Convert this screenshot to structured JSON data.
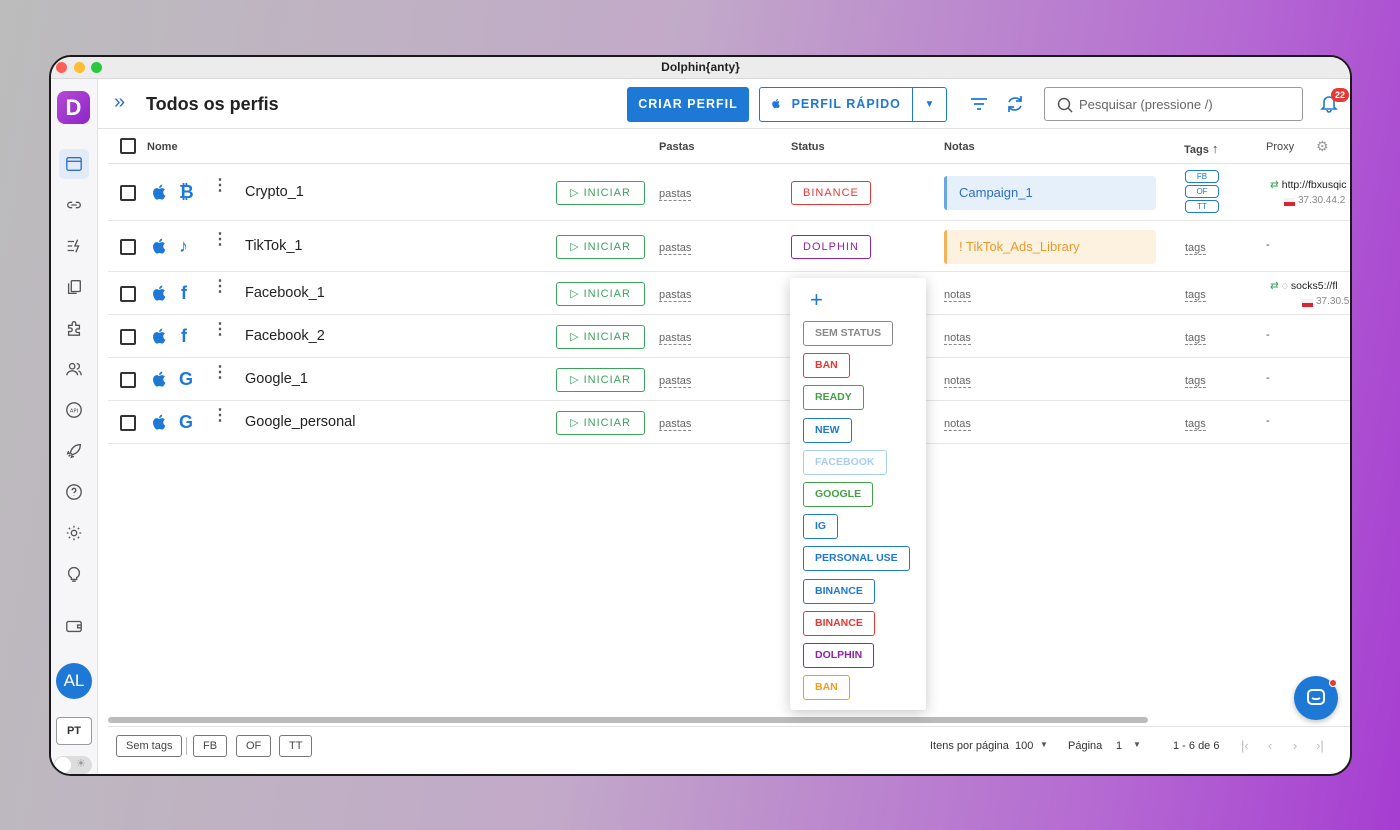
{
  "window": {
    "title": "Dolphin{anty}"
  },
  "sidebar": {
    "logo": "D",
    "avatar": "AL",
    "lang": "PT",
    "theme_toggle_icon": "sun-icon"
  },
  "header": {
    "title": "Todos os perfis",
    "create_button": "CRIAR PERFIL",
    "quick_button": "PERFIL RÁPIDO",
    "search_placeholder": "Pesquisar (pressione /)",
    "notifications": "22"
  },
  "table": {
    "headers": {
      "name": "Nome",
      "folders": "Pastas",
      "status": "Status",
      "notes": "Notas",
      "tags": "Tags",
      "proxy": "Proxy"
    },
    "start_label": "▷ INICIAR",
    "folders_placeholder": "pastas",
    "notes_placeholder": "notas",
    "tags_placeholder": "tags",
    "empty_value": "-",
    "rows": [
      {
        "name": "Crypto_1",
        "brand_icon": "bitcoin-icon",
        "brand": "₿",
        "status": "BINANCE",
        "status_color": "#e53935",
        "note": "Campaign_1",
        "tags": [
          "FB",
          "OF",
          "TT"
        ],
        "proxy": "http://fbxusqic",
        "proxy_ip": "37.30.44.2"
      },
      {
        "name": "TikTok_1",
        "brand_icon": "tiktok-icon",
        "brand": "♪",
        "status": "DOLPHIN",
        "status_color": "#8e24aa",
        "note": "!  TikTok_Ads_Library",
        "tags": [],
        "proxy": "-",
        "proxy_ip": ""
      },
      {
        "name": "Facebook_1",
        "brand_icon": "facebook-icon",
        "brand": "f",
        "status": "",
        "note": "",
        "tags": [],
        "proxy": "socks5://fl",
        "proxy_ip": "37.30.5"
      },
      {
        "name": "Facebook_2",
        "brand_icon": "facebook-icon",
        "brand": "f",
        "status": "",
        "note": "",
        "tags": [],
        "proxy": "-",
        "proxy_ip": ""
      },
      {
        "name": "Google_1",
        "brand_icon": "google-icon",
        "brand": "G",
        "status": "",
        "note": "",
        "tags": [],
        "proxy": "-",
        "proxy_ip": ""
      },
      {
        "name": "Google_personal",
        "brand_icon": "google-icon",
        "brand": "G",
        "status": "",
        "note": "",
        "tags": [],
        "proxy": "-",
        "proxy_ip": ""
      }
    ]
  },
  "status_dropdown": {
    "add_icon": "+",
    "options": [
      {
        "label": "SEM STATUS",
        "color": "#888888"
      },
      {
        "label": "BAN",
        "color": "#e53935"
      },
      {
        "label": "READY",
        "color": "#43a047"
      },
      {
        "label": "NEW",
        "color": "#1e78d6"
      },
      {
        "label": "FACEBOOK",
        "color": "#a9cdee"
      },
      {
        "label": "GOOGLE",
        "color": "#43a047"
      },
      {
        "label": "IG",
        "color": "#1e78d6"
      },
      {
        "label": "PERSONAL USE",
        "color": "#1e78d6"
      },
      {
        "label": "BINANCE",
        "color": "#1e78d6"
      },
      {
        "label": "BINANCE",
        "color": "#e53935"
      },
      {
        "label": "DOLPHIN",
        "color": "#8e24aa"
      },
      {
        "label": "BAN",
        "color": "#f59c1a"
      }
    ]
  },
  "footer": {
    "tags": [
      "Sem tags",
      "FB",
      "OF",
      "TT"
    ],
    "items_per_page_label": "Itens por página",
    "items_per_page": "100",
    "page_label": "Página",
    "page": "1",
    "range": "1 - 6 de 6"
  }
}
